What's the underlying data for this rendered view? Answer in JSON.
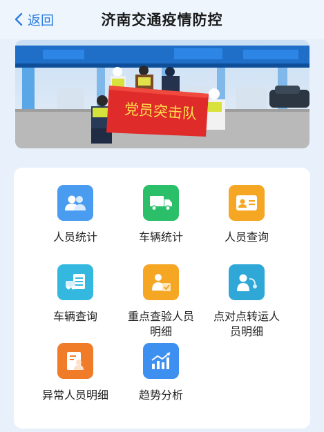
{
  "nav": {
    "back_label": "返回",
    "title": "济南交通疫情防控"
  },
  "banner": {
    "flag_text": "党员突击队"
  },
  "menu": [
    {
      "label": "人员统计",
      "color": "#4a9cf0",
      "icon": "people-icon"
    },
    {
      "label": "车辆统计",
      "color": "#2bbf6a",
      "icon": "truck-icon"
    },
    {
      "label": "人员查询",
      "color": "#f5a623",
      "icon": "id-card-icon"
    },
    {
      "label": "车辆查询",
      "color": "#34b8e0",
      "icon": "vehicle-doc-icon"
    },
    {
      "label": "重点查验人员明细",
      "color": "#f5a623",
      "icon": "person-check-icon"
    },
    {
      "label": "点对点转运人员明细",
      "color": "#2fa8d8",
      "icon": "person-route-icon"
    },
    {
      "label": "异常人员明细",
      "color": "#f07c2a",
      "icon": "abnormal-person-icon"
    },
    {
      "label": "趋势分析",
      "color": "#3d8ff0",
      "icon": "trend-chart-icon"
    }
  ]
}
